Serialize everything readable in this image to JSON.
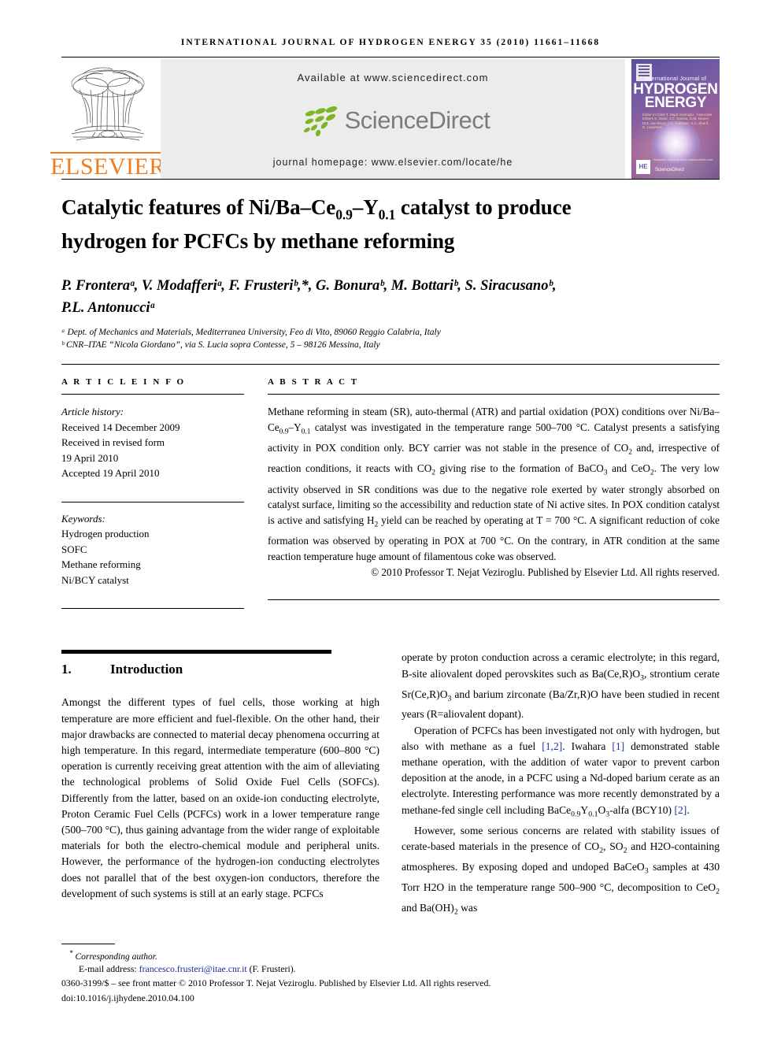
{
  "running_head": "INTERNATIONAL JOURNAL OF HYDROGEN ENERGY 35 (2010) 11661–11668",
  "masthead": {
    "publisher": "ELSEVIER",
    "available_at": "Available at www.sciencedirect.com",
    "sciencedirect_logo_text": "ScienceDirect",
    "journal_homepage": "journal homepage: www.elsevier.com/locate/he",
    "cover": {
      "line_small": "International Journal of",
      "line1": "HYDROGEN",
      "line2": "ENERGY",
      "editors": "Editor-in-Chief  T. Nejat Veziroglu · Associate Editors  S. Dunn, J.C. Santos, G.M. Nunes, M.Z. Jacobson, J.N. Nakhosh, S.A. Sherif, D. Lasarskis",
      "badge": "HE",
      "sciencedirect": "ScienceDirect",
      "sd_caption": "Available online at www.sciencedirect.com"
    },
    "accent_orange": "#F07C1E",
    "sd_green": "#7DB524",
    "sd_grey": "#7c7c7c"
  },
  "article": {
    "title_line1_a": "Catalytic features of Ni/Ba",
    "title_line1_b": "Ce",
    "title_sub1": "0.9",
    "title_line1_c": "Y",
    "title_sub2": "0.1",
    "title_line1_d": " catalyst to produce",
    "title_line2": "hydrogen for PCFCs by methane reforming",
    "authors_line1": "P. Fronteraᵃ, V. Modafferiᵃ, F. Frusteriᵇ,*, G. Bonuraᵇ, M. Bottariᵇ, S. Siracusanoᵇ,",
    "authors_line2": "P.L. Antonucciᵃ",
    "affiliations": [
      "ᵃ Dept. of Mechanics and Materials, Mediterranea University, Feo di Vito, 89060 Reggio Calabria, Italy",
      "ᵇ CNR–ITAE “Nicola Giordano”, via S. Lucia sopra Contesse, 5 – 98126 Messina, Italy"
    ]
  },
  "article_info": {
    "label": "A R T I C L E   I N F O",
    "history_label": "Article history:",
    "history": [
      "Received 14 December 2009",
      "Received in revised form",
      "19 April 2010",
      "Accepted 19 April 2010"
    ],
    "keywords_label": "Keywords:",
    "keywords": [
      "Hydrogen production",
      "SOFC",
      "Methane reforming",
      "Ni/BCY catalyst"
    ]
  },
  "abstract": {
    "label": "A B S T R A C T",
    "paragraph": "Methane reforming in steam (SR), auto-thermal (ATR) and partial oxidation (POX) conditions over Ni/Ba–Ce0.9–Y0.1 catalyst was investigated in the temperature range 500–700 °C. Catalyst presents a satisfying activity in POX condition only. BCY carrier was not stable in the presence of CO2 and, irrespective of reaction conditions, it reacts with CO2 giving rise to the formation of BaCO3 and CeO2. The very low activity observed in SR conditions was due to the negative role exerted by water strongly absorbed on catalyst surface, limiting so the accessibility and reduction state of Ni active sites. In POX condition catalyst is active and satisfying H2 yield can be reached by operating at T = 700 °C. A significant reduction of coke formation was observed by operating in POX at 700 °C. On the contrary, in ATR condition at the same reaction temperature huge amount of filamentous coke was observed.",
    "copyright": "© 2010 Professor T. Nejat Veziroglu. Published by Elsevier Ltd. All rights reserved."
  },
  "body": {
    "section_number": "1.",
    "section_title": "Introduction",
    "left_paragraphs": [
      "Amongst the different types of fuel cells, those working at high temperature are more efficient and fuel-flexible. On the other hand, their major drawbacks are connected to material decay phenomena occurring at high temperature. In this regard, intermediate temperature (600–800 °C) operation is currently receiving great attention with the aim of alleviating the technological problems of Solid Oxide Fuel Cells (SOFCs). Differently from the latter, based on an oxide-ion conducting electrolyte, Proton Ceramic Fuel Cells (PCFCs) work in a lower temperature range (500–700 °C), thus gaining advantage from the wider range of exploitable materials for both the electro-chemical module and peripheral units. However, the performance of the hydrogen-ion conducting electrolytes does not parallel that of the best oxygen-ion conductors, therefore the development of such systems is still at an early stage. PCFCs"
    ],
    "right_paragraphs": [
      "operate by proton conduction across a ceramic electrolyte; in this regard, B-site aliovalent doped perovskites such as Ba(Ce,R)O3, strontium cerate Sr(Ce,R)O3 and barium zirconate (Ba/Zr,R)O have been studied in recent years (R=aliovalent dopant).",
      "Operation of PCFCs has been investigated not only with hydrogen, but also with methane as a fuel [1,2]. Iwahara [1] demonstrated stable methane operation, with the addition of water vapor to prevent carbon deposition at the anode, in a PCFC using a Nd-doped barium cerate as an electrolyte. Interesting performance was more recently demonstrated by a methane-fed single cell including BaCe0.9Y0.1O3-alfa (BCY10) [2].",
      "However, some serious concerns are related with stability issues of cerate-based materials in the presence of CO2, SO2 and H2O-containing atmospheres. By exposing doped and undoped BaCeO3 samples at 430 Torr H2O in the temperature range 500–900 °C, decomposition to CeO2 and Ba(OH)2 was"
    ]
  },
  "footer": {
    "corresponding": "Corresponding author.",
    "email_label": "E-mail address:",
    "email": "francesco.frusteri@itae.cnr.it",
    "email_owner": "(F. Frusteri).",
    "issn_line": "0360-3199/$ – see front matter © 2010 Professor T. Nejat Veziroglu. Published by Elsevier Ltd. All rights reserved.",
    "doi": "doi:10.1016/j.ijhydene.2010.04.100"
  }
}
